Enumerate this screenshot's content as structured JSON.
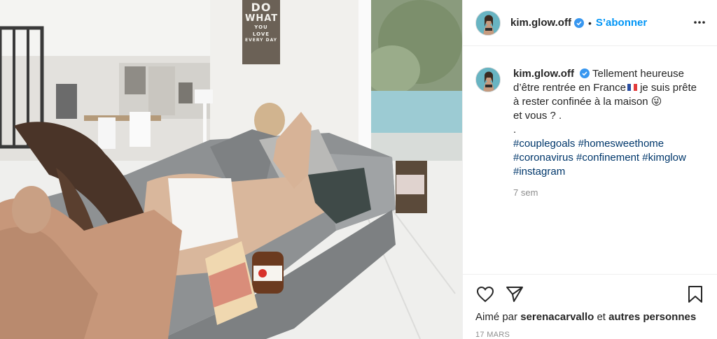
{
  "post": {
    "username": "kim.glow.off",
    "follow_label": "S’abonner",
    "separator": "•",
    "caption_user": "kim.glow.off",
    "caption_line1": "Tellement heureuse d’être rentrée en France",
    "caption_line2": " je suis prête à rester confinée à la maison ",
    "caption_emoji": "😜",
    "caption_line3": " et vous ? .",
    "caption_dot": ".",
    "hashtags": "#couplegoals #homesweethome #coronavirus #confinement #kimglow #instagram",
    "age": "7 sem",
    "liked_prefix": "Aimé par ",
    "liked_user": "serenacarvallo",
    "liked_mid": " et ",
    "liked_others": "autres personnes",
    "date": "17 MARS"
  },
  "photo": {
    "poster_line1": "DO",
    "poster_line2": "WHAT",
    "poster_line3": "YOU LOVE",
    "poster_line4": "EVERY DAY"
  },
  "icons": {
    "verified": "verified-badge-icon",
    "more": "more-options-icon",
    "like": "heart-icon",
    "share": "share-paper-plane-icon",
    "save": "bookmark-icon"
  },
  "colors": {
    "link_blue": "#0095f6",
    "hashtag_blue": "#00376b",
    "muted": "#8e8e8e"
  }
}
